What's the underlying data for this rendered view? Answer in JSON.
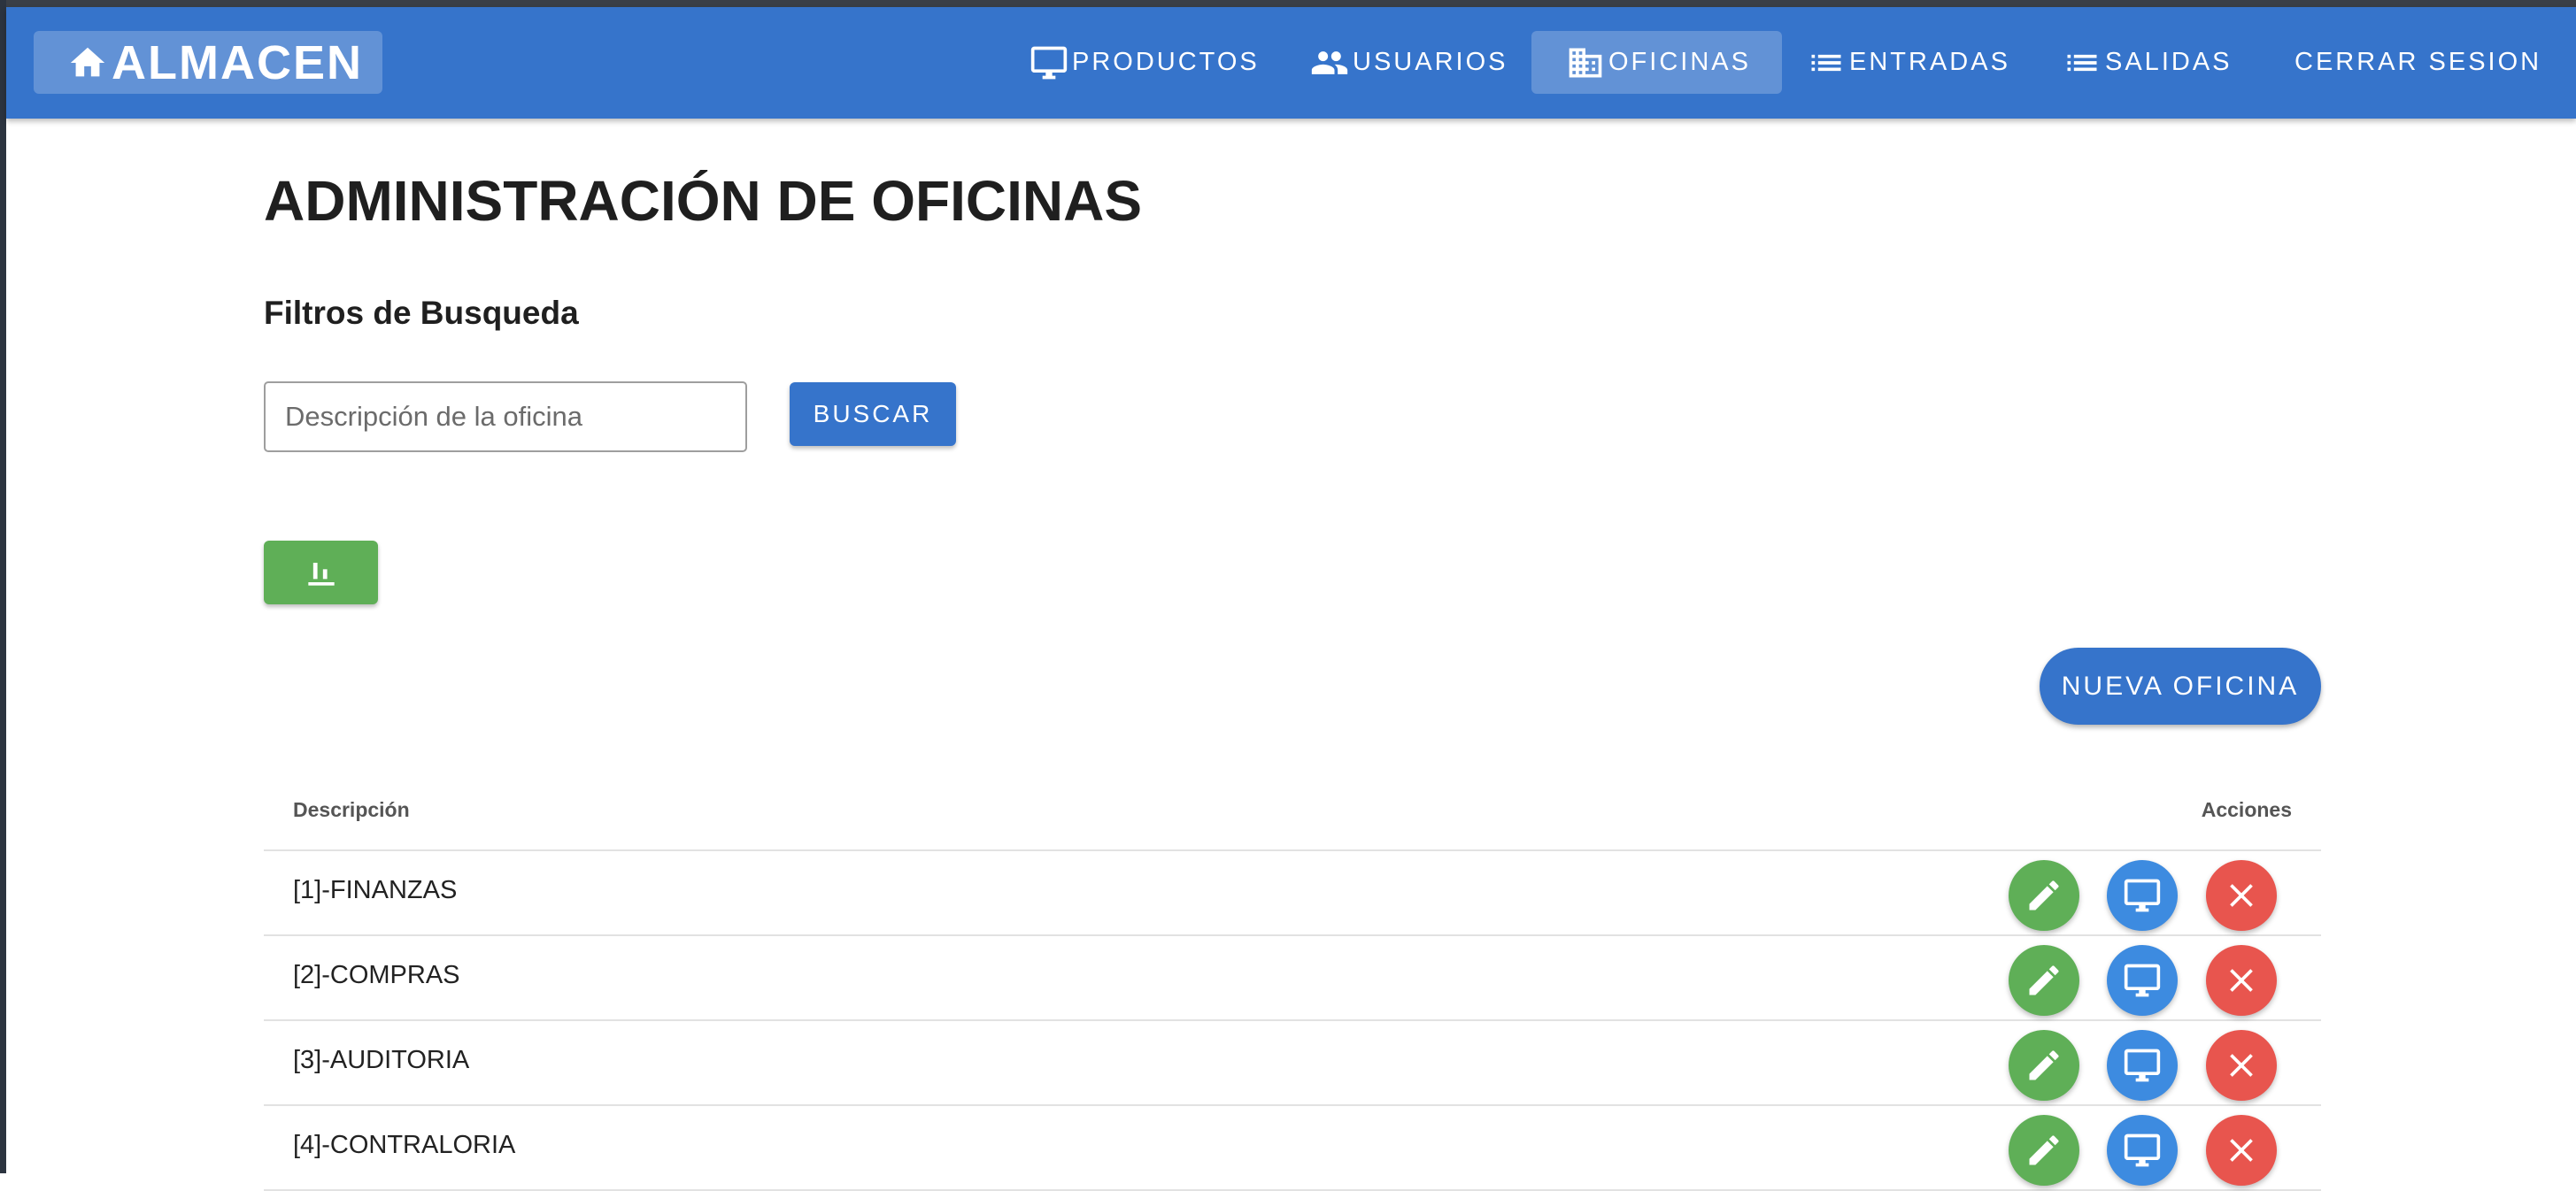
{
  "appbar": {
    "brand": "ALMACEN",
    "brand_icon": "home-icon",
    "nav": [
      {
        "label": "PRODUCTOS",
        "icon": "monitor-icon"
      },
      {
        "label": "USUARIOS",
        "icon": "users-icon"
      },
      {
        "label": "OFICINAS",
        "icon": "building-icon",
        "active": true
      },
      {
        "label": "ENTRADAS",
        "icon": "list-icon"
      },
      {
        "label": "SALIDAS",
        "icon": "list-icon"
      },
      {
        "label": "CERRAR SESION"
      }
    ]
  },
  "page": {
    "title": "ADMINISTRACIÓN DE OFICINAS",
    "filters_title": "Filtros de Busqueda"
  },
  "search": {
    "placeholder": "Descripción de la oficina",
    "value": "",
    "button_label": "BUSCAR"
  },
  "chart_button_icon": "bar-chart-icon",
  "new_button_label": "NUEVA OFICINA",
  "table": {
    "headers": {
      "description": "Descripción",
      "actions": "Acciones"
    },
    "rows": [
      {
        "description": "[1]-FINANZAS"
      },
      {
        "description": "[2]-COMPRAS"
      },
      {
        "description": "[3]-AUDITORIA"
      },
      {
        "description": "[4]-CONTRALORIA"
      }
    ],
    "row_actions": [
      "edit-icon",
      "monitor-icon",
      "close-icon"
    ]
  },
  "colors": {
    "primary": "#3674CB",
    "success": "#5FAF57",
    "info": "#3D8BE0",
    "danger": "#E8554E"
  }
}
